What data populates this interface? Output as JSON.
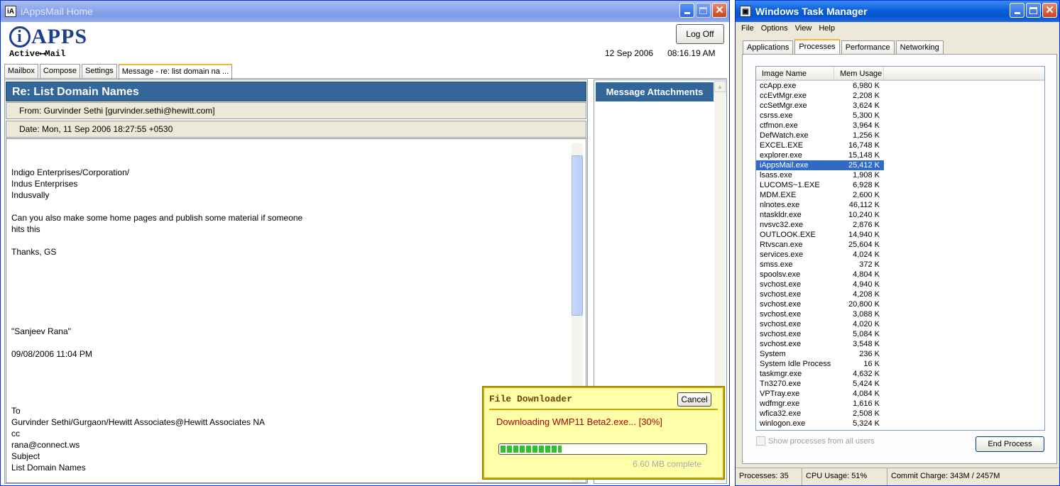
{
  "iapps": {
    "window_title": "iAppsMail Home",
    "title_icon": "iA",
    "logo_i": "i",
    "logo_main": "APPS",
    "logo_sub": "Active⟷Mail",
    "logoff_label": "Log Off",
    "date": "12 Sep 2006",
    "time": "08:16.19 AM",
    "tabs": [
      "Mailbox",
      "Compose",
      "Settings",
      "Message - re: list domain na ..."
    ],
    "message": {
      "subject": "Re: List Domain Names",
      "from": "From: Gurvinder Sethi [gurvinder.sethi@hewitt.com]",
      "date": "Date:  Mon, 11 Sep 2006 18:27:55 +0530",
      "body": "Indigo Enterprises/Corporation/\nIndus Enterprises\nIndusvally\n\nCan you also make some home pages and publish some material if someone\nhits this\n\nThanks, GS\n\n\n\n\n\n\n\"Sanjeev Rana\"\n\n09/08/2006 11:04 PM\n\n\n\n\nTo\nGurvinder Sethi/Gurgaon/Hewitt Associates@Hewitt Associates NA\ncc\nrana@connect.ws\nSubject\nList Domain Names"
    },
    "attachments_title": "Message Attachments",
    "downloader": {
      "title": "File Downloader",
      "cancel_label": "Cancel",
      "status": "Downloading WMP11 Beta2.exe... [30%]",
      "progress": 0.3,
      "size_text": "6.60 MB complete"
    }
  },
  "taskmgr": {
    "window_title": "Windows Task Manager",
    "menu": [
      "File",
      "Options",
      "View",
      "Help"
    ],
    "tabs": [
      "Applications",
      "Processes",
      "Performance",
      "Networking"
    ],
    "columns": [
      "Image Name",
      "Mem Usage"
    ],
    "processes": [
      [
        "ccApp.exe",
        "6,980 K"
      ],
      [
        "ccEvtMgr.exe",
        "2,208 K"
      ],
      [
        "ccSetMgr.exe",
        "3,624 K"
      ],
      [
        "csrss.exe",
        "5,300 K"
      ],
      [
        "ctfmon.exe",
        "3,964 K"
      ],
      [
        "DefWatch.exe",
        "1,256 K"
      ],
      [
        "EXCEL.EXE",
        "16,748 K"
      ],
      [
        "explorer.exe",
        "15,148 K"
      ],
      [
        "iAppsMail.exe",
        "25,412 K"
      ],
      [
        "lsass.exe",
        "1,908 K"
      ],
      [
        "LUCOMS~1.EXE",
        "6,928 K"
      ],
      [
        "MDM.EXE",
        "2,600 K"
      ],
      [
        "nlnotes.exe",
        "46,112 K"
      ],
      [
        "ntaskldr.exe",
        "10,240 K"
      ],
      [
        "nvsvc32.exe",
        "2,876 K"
      ],
      [
        "OUTLOOK.EXE",
        "14,940 K"
      ],
      [
        "Rtvscan.exe",
        "25,604 K"
      ],
      [
        "services.exe",
        "4,024 K"
      ],
      [
        "smss.exe",
        "372 K"
      ],
      [
        "spoolsv.exe",
        "4,804 K"
      ],
      [
        "svchost.exe",
        "4,940 K"
      ],
      [
        "svchost.exe",
        "4,208 K"
      ],
      [
        "svchost.exe",
        "20,800 K"
      ],
      [
        "svchost.exe",
        "3,088 K"
      ],
      [
        "svchost.exe",
        "4,020 K"
      ],
      [
        "svchost.exe",
        "5,084 K"
      ],
      [
        "svchost.exe",
        "3,548 K"
      ],
      [
        "System",
        "236 K"
      ],
      [
        "System Idle Process",
        "16 K"
      ],
      [
        "taskmgr.exe",
        "4,632 K"
      ],
      [
        "Tn3270.exe",
        "5,424 K"
      ],
      [
        "VPTray.exe",
        "4,084 K"
      ],
      [
        "wdfmgr.exe",
        "1,616 K"
      ],
      [
        "wfica32.exe",
        "2,508 K"
      ],
      [
        "winlogon.exe",
        "5,324 K"
      ]
    ],
    "selected_process": "iAppsMail.exe",
    "show_all_label": "Show processes from all users",
    "end_process_label": "End Process",
    "status": {
      "processes": "Processes: 35",
      "cpu": "CPU Usage: 51%",
      "commit": "Commit Charge: 343M / 2457M"
    }
  }
}
